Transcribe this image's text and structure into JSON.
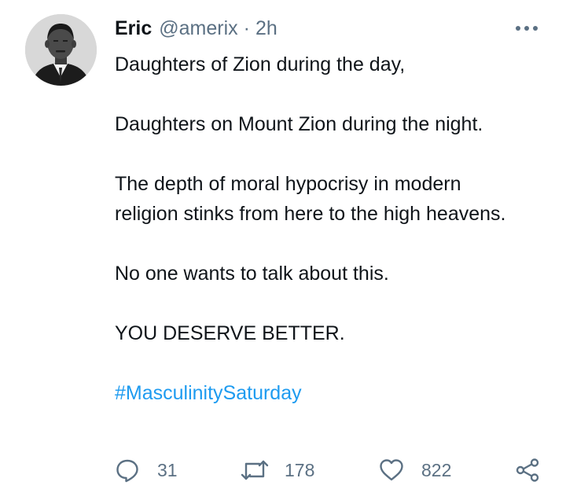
{
  "author": {
    "name": "Eric",
    "handle": "@amerix",
    "separator": "·",
    "time": "2h",
    "avatar_icon": "profile-photo"
  },
  "more_icon": "more-horizontal-icon",
  "tweet": {
    "lines": {
      "p1": "Daughters of Zion during the day,",
      "p2": "Daughters on Mount Zion during the night.",
      "p3": "The depth of moral hypocrisy in modern religion stinks from here to the high heavens.",
      "p4": "No one wants to talk about this.",
      "p5": "YOU DESERVE BETTER.",
      "hashtag": "#MasculinitySaturday"
    }
  },
  "actions": {
    "reply": {
      "icon": "reply-icon",
      "count": "31"
    },
    "retweet": {
      "icon": "retweet-icon",
      "count": "178"
    },
    "like": {
      "icon": "heart-icon",
      "count": "822"
    },
    "share": {
      "icon": "share-icon"
    }
  },
  "colors": {
    "text": "#0f1419",
    "secondary": "#5b7083",
    "link": "#1d9bf0"
  }
}
